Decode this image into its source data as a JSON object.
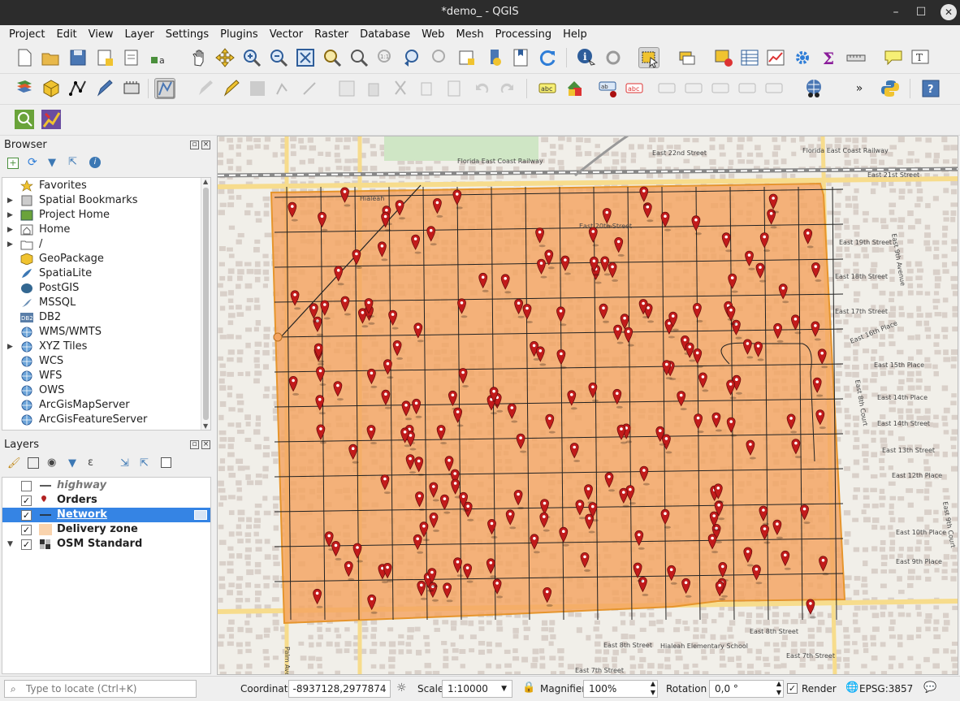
{
  "window": {
    "title": "*demo_ - QGIS"
  },
  "menus": [
    "Project",
    "Edit",
    "View",
    "Layer",
    "Settings",
    "Plugins",
    "Vector",
    "Raster",
    "Database",
    "Web",
    "Mesh",
    "Processing",
    "Help"
  ],
  "browser": {
    "title": "Browser",
    "items": [
      {
        "label": "Favorites",
        "icon": "star-icon",
        "expandable": false
      },
      {
        "label": "Spatial Bookmarks",
        "icon": "bookmark-icon",
        "expandable": true
      },
      {
        "label": "Project Home",
        "icon": "project-home-icon",
        "expandable": true
      },
      {
        "label": "Home",
        "icon": "home-icon",
        "expandable": true
      },
      {
        "label": "/",
        "icon": "folder-icon",
        "expandable": true
      },
      {
        "label": "GeoPackage",
        "icon": "geopackage-icon",
        "expandable": false
      },
      {
        "label": "SpatiaLite",
        "icon": "spatialite-icon",
        "expandable": false
      },
      {
        "label": "PostGIS",
        "icon": "postgis-icon",
        "expandable": false
      },
      {
        "label": "MSSQL",
        "icon": "mssql-icon",
        "expandable": false
      },
      {
        "label": "DB2",
        "icon": "db2-icon",
        "expandable": false
      },
      {
        "label": "WMS/WMTS",
        "icon": "globe-icon",
        "expandable": false
      },
      {
        "label": "XYZ Tiles",
        "icon": "globe-icon",
        "expandable": true
      },
      {
        "label": "WCS",
        "icon": "globe-icon",
        "expandable": false
      },
      {
        "label": "WFS",
        "icon": "globe-icon",
        "expandable": false
      },
      {
        "label": "OWS",
        "icon": "globe-icon",
        "expandable": false
      },
      {
        "label": "ArcGisMapServer",
        "icon": "globe-icon",
        "expandable": false
      },
      {
        "label": "ArcGisFeatureServer",
        "icon": "globe-icon",
        "expandable": false
      }
    ]
  },
  "layers": {
    "title": "Layers",
    "items": [
      {
        "label": "highway",
        "checked": false,
        "symbol": "line",
        "italic": true,
        "selected": false
      },
      {
        "label": "Orders",
        "checked": true,
        "symbol": "pin",
        "italic": false,
        "selected": false
      },
      {
        "label": "Network",
        "checked": true,
        "symbol": "line",
        "italic": false,
        "selected": true
      },
      {
        "label": "Delivery zone",
        "checked": true,
        "symbol": "fill",
        "italic": false,
        "selected": false
      },
      {
        "label": "OSM Standard",
        "checked": true,
        "symbol": "raster",
        "italic": false,
        "selected": false
      }
    ]
  },
  "map": {
    "zone_color": "#f4a460",
    "street_labels": [
      "East 22nd Street",
      "Florida East Coast Railway",
      "Florida East Coast Railway",
      "East 21st Street",
      "Hialeah",
      "East 20th Street",
      "East 19th Street",
      "East 18th Street",
      "East 17th Street",
      "East 16th Place",
      "East 15th Place",
      "East 14th Place",
      "East 14th Street",
      "East 13th Street",
      "East 12th Place",
      "East 10th Place",
      "East 9th Place",
      "East 8th Street",
      "East 8th Street",
      "East 7th Street",
      "East 7th Street",
      "East 9th Avenue",
      "East 8th Court",
      "Palm Avenue",
      "Hialeah Elementary School",
      "East 9th Court"
    ]
  },
  "status": {
    "search_placeholder": "Type to locate (Ctrl+K)",
    "coordinate_label": "Coordinate",
    "coordinate_value": "-8937128,2977874",
    "scale_label": "Scale",
    "scale_value": "1:10000",
    "magnifier_label": "Magnifier",
    "magnifier_value": "100%",
    "rotation_label": "Rotation",
    "rotation_value": "0,0 °",
    "render_label": "Render",
    "render_checked": true,
    "crs_label": "EPSG:3857"
  }
}
